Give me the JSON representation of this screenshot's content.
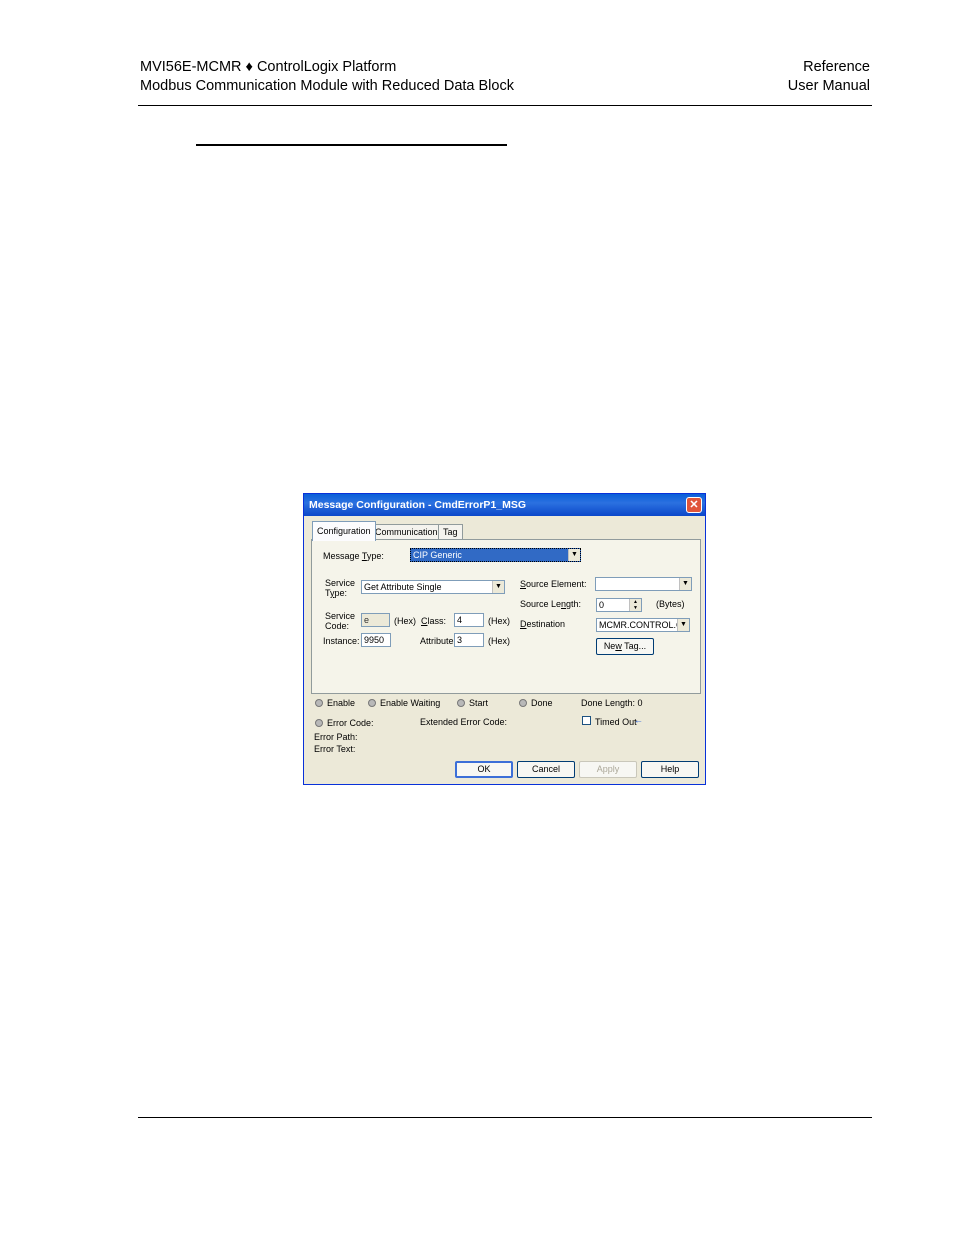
{
  "header": {
    "left_line1": "MVI56E-MCMR ♦ ControlLogix Platform",
    "left_line2": "Modbus Communication Module with Reduced Data Block",
    "right_line1": "Reference",
    "right_line2": "User Manual"
  },
  "dialog": {
    "title": "Message Configuration - CmdErrorP1_MSG",
    "close_glyph": "✕",
    "tabs": [
      "Configuration",
      "Communication",
      "Tag"
    ],
    "message_type": {
      "pre": "Message ",
      "ul": "T",
      "post": "ype:",
      "value": "CIP Generic"
    },
    "service_type": {
      "line1": "Service",
      "pre2": "T",
      "ul2": "y",
      "post2": "pe:",
      "value": "Get Attribute Single"
    },
    "service_code": {
      "line1": "Service",
      "line2": "Code:",
      "value": "e",
      "unit": "(Hex)"
    },
    "class": {
      "ul": "C",
      "post": "lass:",
      "value": "4",
      "unit": "(Hex)"
    },
    "instance": {
      "label": "Instance:",
      "value": "9950"
    },
    "attribute": {
      "label": "Attribute:",
      "value": "3",
      "unit": "(Hex)"
    },
    "source_element": {
      "ul": "S",
      "post": "ource Element:",
      "value": ""
    },
    "source_length": {
      "pre": "Source Le",
      "ul": "n",
      "post": "gth:",
      "value": "0",
      "unit": "(Bytes)"
    },
    "destination": {
      "ul": "D",
      "post": "estination",
      "value": "MCMR.CONTROL.C"
    },
    "new_tag": {
      "pre": "Ne",
      "ul": "w",
      "post": " Tag..."
    },
    "status": {
      "enable": "Enable",
      "enable_waiting": "Enable Waiting",
      "start": "Start",
      "done": "Done",
      "done_length": "Done Length:  0",
      "error_code": "Error Code:",
      "extended_error_code": "Extended Error Code:",
      "timed_out": "Timed Out",
      "error_path": "Error Path:",
      "error_text": "Error Text:"
    },
    "buttons": {
      "ok": "OK",
      "cancel": "Cancel",
      "apply": "Apply",
      "help": "Help"
    }
  }
}
